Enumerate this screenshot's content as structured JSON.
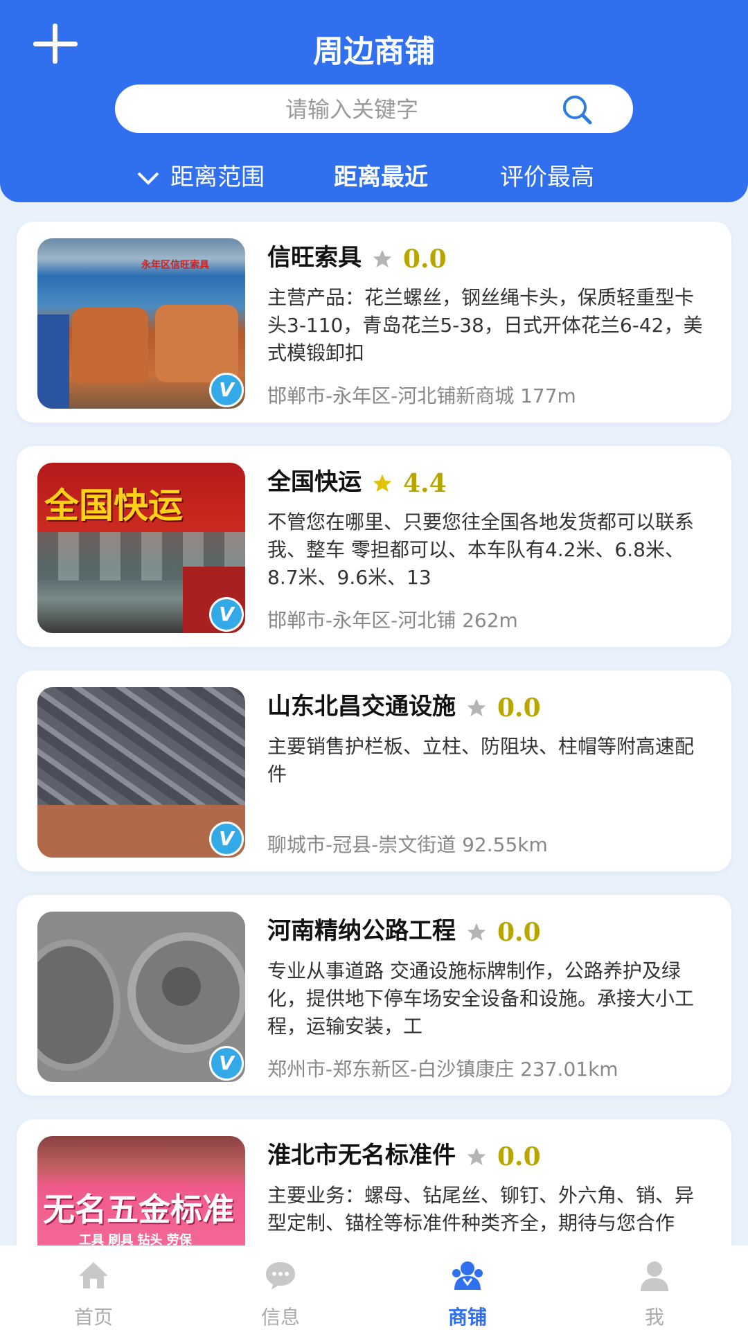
{
  "header": {
    "title": "周边商铺",
    "search_placeholder": "请输入关键字",
    "filters": [
      "距离范围",
      "距离最近",
      "评价最高"
    ]
  },
  "colors": {
    "primary": "#3070ee",
    "rating": "#b8a600",
    "star_active": "#e0c200",
    "star_inactive": "#b5b5b5"
  },
  "shops": [
    {
      "name": "信旺索具",
      "rating": "0.0",
      "star_active": false,
      "desc": "主营产品：花兰螺丝，钢丝绳卡头，保质轻重型卡头3-110，青岛花兰5-38，日式开体花兰6-42，美式模锻卸扣",
      "location": "邯郸市-永年区-河北铺新商城 177m",
      "thumb_text": "永年区信旺索具",
      "verified_label": "V"
    },
    {
      "name": "全国快运",
      "rating": "4.4",
      "star_active": true,
      "desc": "不管您在哪里、只要您往全国各地发货都可以联系我、整车 零担都可以、本车队有4.2米、6.8米、8.7米、9.6米、13",
      "location": "邯郸市-永年区-河北铺 262m",
      "thumb_text": "全国快运",
      "verified_label": "V"
    },
    {
      "name": "山东北昌交通设施",
      "rating": "0.0",
      "star_active": false,
      "desc": "主要销售护栏板、立柱、防阻块、柱帽等附高速配件",
      "location": "聊城市-冠县-崇文街道 92.55km",
      "thumb_text": "",
      "verified_label": "V"
    },
    {
      "name": "河南精纳公路工程",
      "rating": "0.0",
      "star_active": false,
      "desc": "专业从事道路 交通设施标牌制作，公路养护及绿化，提供地下停车场安全设备和设施。承接大小工程，运输安装，工",
      "location": "郑州市-郑东新区-白沙镇康庄 237.01km",
      "thumb_text": "",
      "verified_label": "V"
    },
    {
      "name": "淮北市无名标准件",
      "rating": "0.0",
      "star_active": false,
      "desc": "主要业务：螺母、钻尾丝、铆钉、外六角、销、异型定制、锚栓等标准件种类齐全，期待与您合作",
      "location": "",
      "thumb_text": "无名五金标准",
      "thumb_subtext": "工具 刷具 钻头 劳保",
      "verified_label": "V"
    }
  ],
  "tabbar": [
    {
      "label": "首页",
      "icon": "home-icon",
      "active": false
    },
    {
      "label": "信息",
      "icon": "message-icon",
      "active": false
    },
    {
      "label": "商铺",
      "icon": "shop-icon",
      "active": true
    },
    {
      "label": "我",
      "icon": "user-icon",
      "active": false
    }
  ]
}
